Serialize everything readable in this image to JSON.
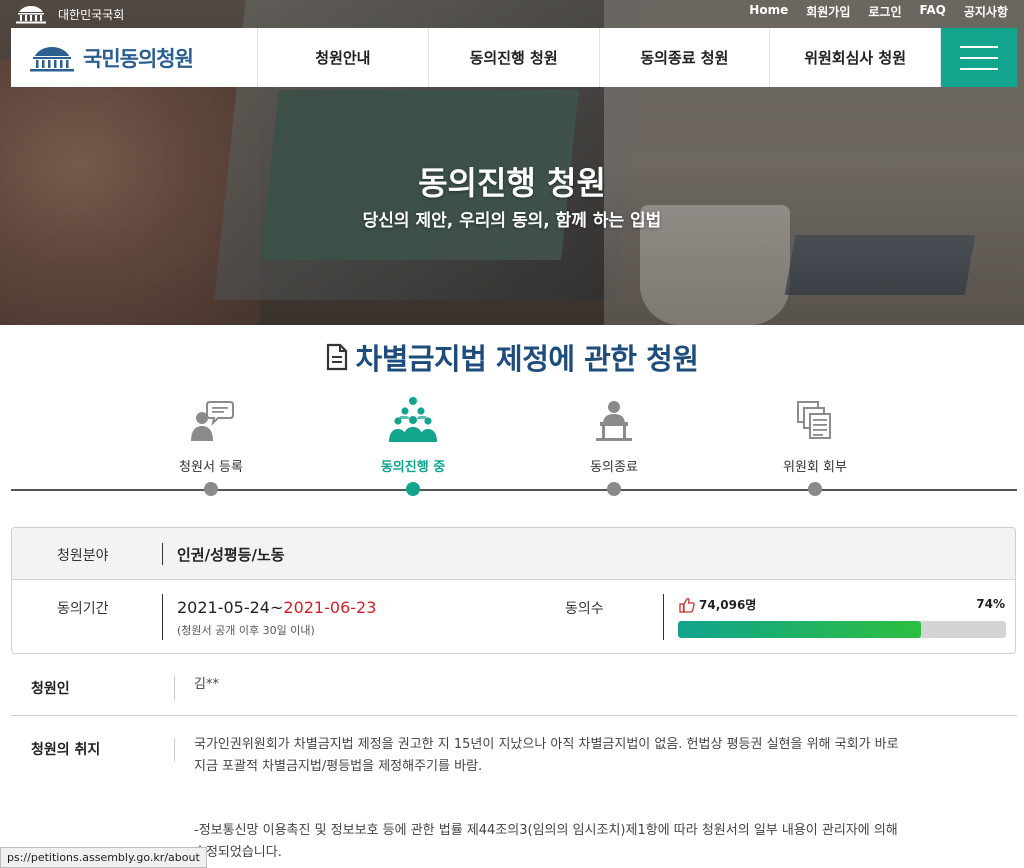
{
  "util": {
    "assembly_name": "대한민국국회",
    "links": [
      "Home",
      "회원가입",
      "로그인",
      "FAQ",
      "공지사항"
    ]
  },
  "nav": {
    "logo_text": "국민동의청원",
    "items": [
      "청원안내",
      "동의진행 청원",
      "동의종료 청원",
      "위원회심사 청원"
    ]
  },
  "hero": {
    "title": "동의진행 청원",
    "subtitle": "당신의 제안, 우리의 동의, 함께 하는 입법"
  },
  "petition": {
    "title": "차별금지법 제정에 관한 청원"
  },
  "steps": [
    {
      "label": "청원서 등록",
      "icon": "speech-person-icon",
      "active": false
    },
    {
      "label": "동의진행 중",
      "icon": "group-people-icon",
      "active": true
    },
    {
      "label": "동의종료",
      "icon": "podium-person-icon",
      "active": false
    },
    {
      "label": "위원회 회부",
      "icon": "document-stack-icon",
      "active": false
    }
  ],
  "info": {
    "category_label": "청원분야",
    "category_value": "인권/성평등/노동",
    "period_label": "동의기간",
    "period_start": "2021-05-24~",
    "period_end": "2021-06-23",
    "period_note": "(청원서 공개 이후 30일 이내)",
    "agree_label": "동의수",
    "agree_count": "74,096명",
    "agree_percent_text": "74%",
    "agree_percent": 74
  },
  "petitioner": {
    "label": "청원인",
    "value": "김**"
  },
  "purpose": {
    "label": "청원의 취지",
    "line1": "국가인권위원회가 차별금지법 제정을 권고한 지 15년이 지났으나 아직 차별금지법이 없음. 헌법상 평등권 실현을 위해 국회가 바로",
    "line2": "지금 포괄적 차별금지법/평등법을 제정해주기를 바람.",
    "notice1": "-정보통신망 이용촉진 및 정보보호 등에 관한 법률 제44조의3(임의의 임시조치)제1항에 따라 청원서의 일부 내용이 관리자에 의해",
    "notice2": "수정되었습니다."
  },
  "statusbar": {
    "url": "ps://petitions.assembly.go.kr/about"
  },
  "colors": {
    "accent": "#12a48d",
    "title_blue": "#1e4d7b",
    "end_date_red": "#d0202a"
  }
}
